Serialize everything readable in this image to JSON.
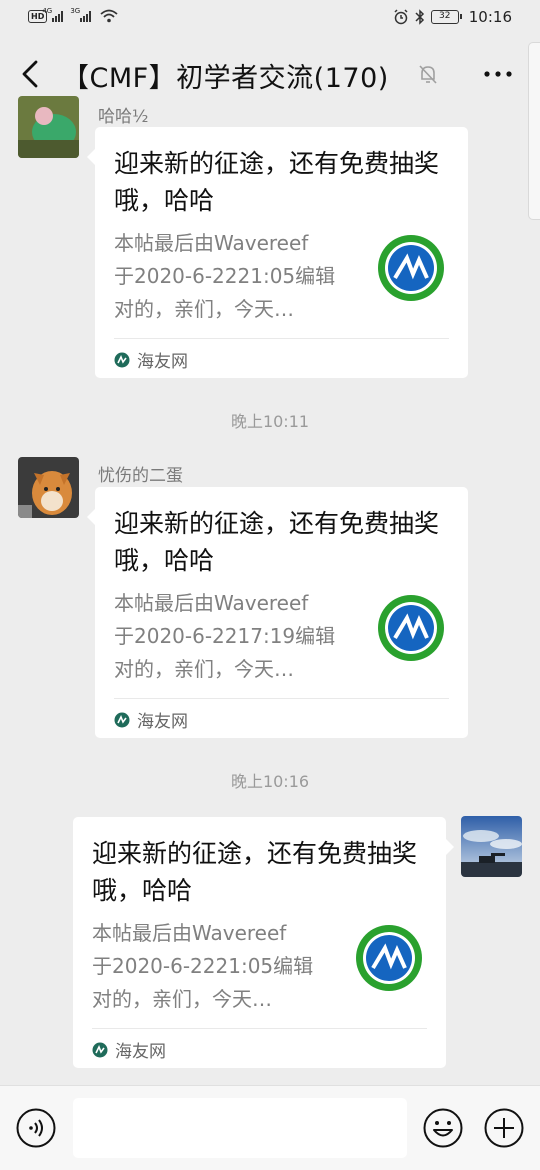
{
  "status_bar": {
    "hd": "HD",
    "net1": "4G",
    "net2": "3G",
    "battery": "32",
    "time": "10:16"
  },
  "header": {
    "title": "【CMF】初学者交流(170)",
    "back_icon": "chevron-left-icon",
    "mute_icon": "bell-off-icon",
    "more_icon": "ellipsis-icon"
  },
  "messages": [
    {
      "sender": "哈哈½",
      "side": "left",
      "card": {
        "title": "迎来新的征途，还有免费抽奖哦，哈哈",
        "desc_lines": [
          "本帖最后由Wavereef",
          "于2020-6-2221:05编辑",
          "对的，亲们，今天…"
        ],
        "source": "海友网"
      }
    },
    {
      "timestamp": "晚上10:11"
    },
    {
      "sender": "忧伤的二蛋",
      "side": "left",
      "card": {
        "title": "迎来新的征途，还有免费抽奖哦，哈哈",
        "desc_lines": [
          "本帖最后由Wavereef",
          "于2020-6-2217:19编辑",
          "对的，亲们，今天…"
        ],
        "source": "海友网"
      }
    },
    {
      "timestamp": "晚上10:16"
    },
    {
      "side": "right",
      "card": {
        "title": "迎来新的征途，还有免费抽奖哦，哈哈",
        "desc_lines": [
          "本帖最后由Wavereef",
          "于2020-6-2221:05编辑",
          "对的，亲们，今天…"
        ],
        "source": "海友网"
      }
    }
  ],
  "input_bar": {
    "voice_icon": "voice-icon",
    "emoji_icon": "emoji-icon",
    "plus_icon": "plus-icon"
  },
  "colors": {
    "background": "#ededed",
    "card": "#ffffff",
    "logo_green": "#2aa12e",
    "logo_blue": "#1565c0"
  }
}
